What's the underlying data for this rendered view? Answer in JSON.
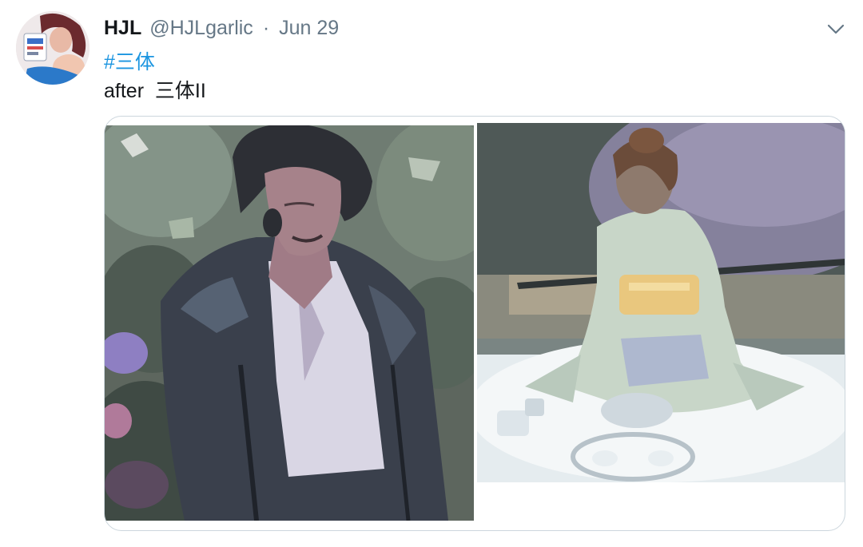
{
  "tweet": {
    "display_name": "HJL",
    "handle": "@HJLgarlic",
    "separator": "·",
    "date": "Jun 29",
    "hashtag": "#三体",
    "text": "after  三体II"
  },
  "icons": {
    "menu": "chevron-down-icon"
  },
  "colors": {
    "name": "#14171a",
    "secondary": "#657786",
    "link": "#1b95e0",
    "border": "#ccd6dd"
  }
}
